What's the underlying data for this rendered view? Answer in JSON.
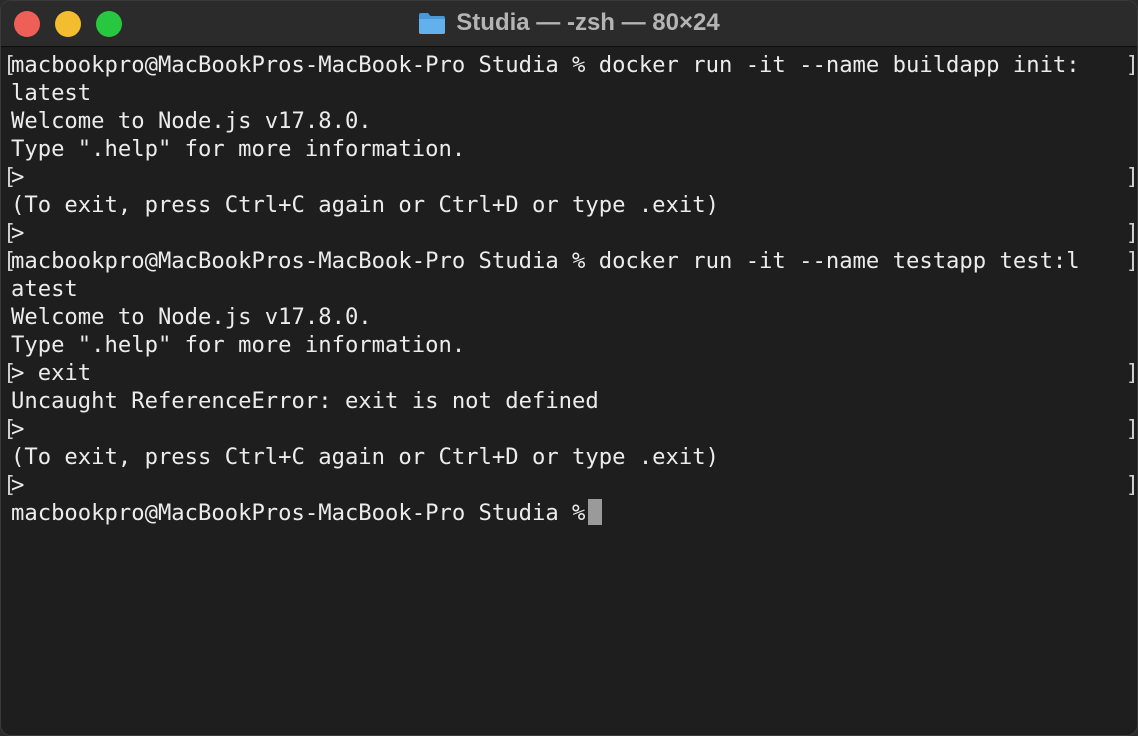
{
  "window": {
    "title": "Studia — -zsh — 80×24"
  },
  "terminal": {
    "lines": [
      {
        "text": "macbookpro@MacBookPros-MacBook-Pro Studia % docker run -it --name buildapp init:",
        "bl": "[",
        "br": "]"
      },
      {
        "text": "latest",
        "bl": "",
        "br": ""
      },
      {
        "text": "Welcome to Node.js v17.8.0.",
        "bl": "",
        "br": ""
      },
      {
        "text": "Type \".help\" for more information.",
        "bl": "",
        "br": ""
      },
      {
        "text": ">",
        "bl": "[",
        "br": "]"
      },
      {
        "text": "(To exit, press Ctrl+C again or Ctrl+D or type .exit)",
        "bl": "",
        "br": ""
      },
      {
        "text": ">",
        "bl": "[",
        "br": "]"
      },
      {
        "text": "macbookpro@MacBookPros-MacBook-Pro Studia % docker run -it --name testapp test:l",
        "bl": "[",
        "br": "]"
      },
      {
        "text": "atest",
        "bl": "",
        "br": ""
      },
      {
        "text": "Welcome to Node.js v17.8.0.",
        "bl": "",
        "br": ""
      },
      {
        "text": "Type \".help\" for more information.",
        "bl": "",
        "br": ""
      },
      {
        "text": "> exit",
        "bl": "[",
        "br": "]"
      },
      {
        "text": "Uncaught ReferenceError: exit is not defined",
        "bl": "",
        "br": ""
      },
      {
        "text": ">",
        "bl": "[",
        "br": "]"
      },
      {
        "text": "(To exit, press Ctrl+C again or Ctrl+D or type .exit)",
        "bl": "",
        "br": ""
      },
      {
        "text": ">",
        "bl": "[",
        "br": "]"
      }
    ],
    "prompt": "macbookpro@MacBookPros-MacBook-Pro Studia %"
  },
  "colors": {
    "background": "#1e1e1e",
    "titlebar": "#2b2b2b",
    "text": "#ececec",
    "close": "#ee5f57",
    "minimize": "#f3bd2f",
    "maximize": "#27c840",
    "folder": "#5aa9e6"
  },
  "icons": {
    "folder": "folder-icon"
  }
}
